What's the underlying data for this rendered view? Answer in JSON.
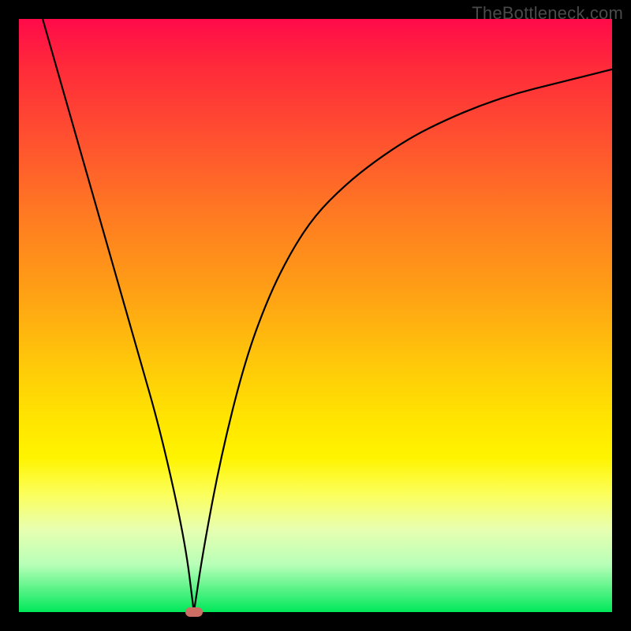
{
  "watermark": "TheBottleneck.com",
  "chart_data": {
    "type": "line",
    "title": "",
    "xlabel": "",
    "ylabel": "",
    "xlim": [
      0,
      100
    ],
    "ylim": [
      0,
      100
    ],
    "grid": false,
    "series": [
      {
        "name": "curve",
        "x": [
          4,
          8,
          12,
          16,
          20,
          24,
          28,
          29.5,
          31,
          34,
          38,
          42,
          46,
          50,
          55,
          60,
          66,
          72,
          78,
          84,
          90,
          96,
          100
        ],
        "y": [
          100,
          86,
          72,
          58,
          44,
          30,
          12,
          0,
          10,
          26,
          42,
          53,
          61,
          67,
          72,
          76,
          80,
          83,
          85.5,
          87.5,
          89,
          90.5,
          91.5
        ]
      }
    ],
    "marker": {
      "x": 29.5,
      "y": 0
    },
    "gradient_stops": [
      {
        "pct": 0,
        "color": "#ff0a4a"
      },
      {
        "pct": 50,
        "color": "#ffc800"
      },
      {
        "pct": 80,
        "color": "#fdff60"
      },
      {
        "pct": 100,
        "color": "#00e85a"
      }
    ]
  }
}
